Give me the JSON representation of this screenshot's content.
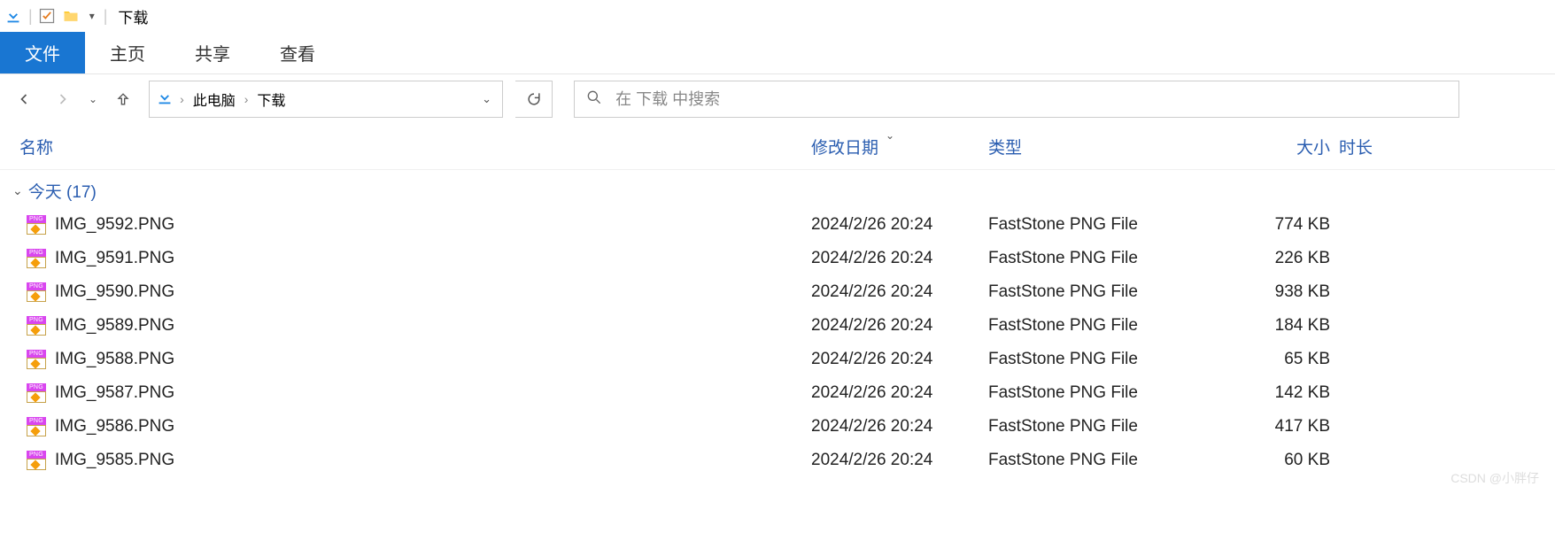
{
  "window": {
    "title": "下载"
  },
  "ribbon": {
    "tabs": [
      {
        "label": "文件",
        "active": true
      },
      {
        "label": "主页",
        "active": false
      },
      {
        "label": "共享",
        "active": false
      },
      {
        "label": "查看",
        "active": false
      }
    ]
  },
  "breadcrumb": {
    "parts": [
      "此电脑",
      "下载"
    ]
  },
  "search": {
    "placeholder": "在 下载 中搜索"
  },
  "columns": {
    "name": "名称",
    "date": "修改日期",
    "type": "类型",
    "size": "大小",
    "duration": "时长"
  },
  "group": {
    "label": "今天 (17)"
  },
  "files": [
    {
      "name": "IMG_9592.PNG",
      "date": "2024/2/26 20:24",
      "type": "FastStone PNG File",
      "size": "774 KB"
    },
    {
      "name": "IMG_9591.PNG",
      "date": "2024/2/26 20:24",
      "type": "FastStone PNG File",
      "size": "226 KB"
    },
    {
      "name": "IMG_9590.PNG",
      "date": "2024/2/26 20:24",
      "type": "FastStone PNG File",
      "size": "938 KB"
    },
    {
      "name": "IMG_9589.PNG",
      "date": "2024/2/26 20:24",
      "type": "FastStone PNG File",
      "size": "184 KB"
    },
    {
      "name": "IMG_9588.PNG",
      "date": "2024/2/26 20:24",
      "type": "FastStone PNG File",
      "size": "65 KB"
    },
    {
      "name": "IMG_9587.PNG",
      "date": "2024/2/26 20:24",
      "type": "FastStone PNG File",
      "size": "142 KB"
    },
    {
      "name": "IMG_9586.PNG",
      "date": "2024/2/26 20:24",
      "type": "FastStone PNG File",
      "size": "417 KB"
    },
    {
      "name": "IMG_9585.PNG",
      "date": "2024/2/26 20:24",
      "type": "FastStone PNG File",
      "size": "60 KB"
    }
  ],
  "watermark": "CSDN @小胖仔"
}
